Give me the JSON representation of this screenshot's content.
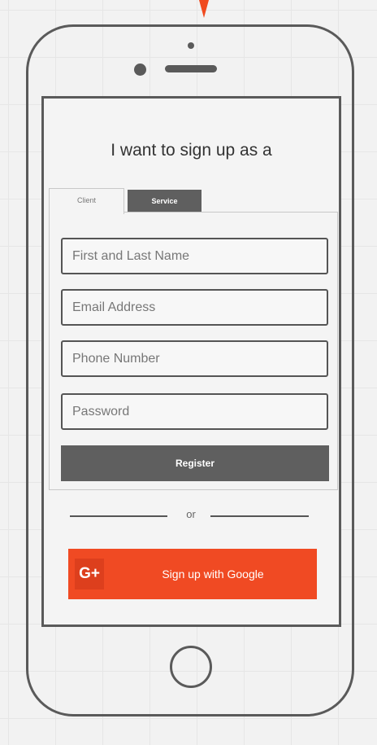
{
  "form": {
    "title": "I want to sign up as a",
    "tabs": [
      {
        "label": "Client",
        "active": true
      },
      {
        "label": "Service",
        "active": false
      }
    ],
    "fields": {
      "name_placeholder": "First and Last Name",
      "email_placeholder": "Email Address",
      "phone_placeholder": "Phone Number",
      "password_placeholder": "Password"
    },
    "register_label": "Register",
    "divider_text": "or",
    "google": {
      "icon_text": "G+",
      "label": "Sign up with Google"
    }
  },
  "colors": {
    "accent": "#f04a23",
    "button_dark": "#5f5f5f",
    "outline": "#5a5a5a"
  }
}
